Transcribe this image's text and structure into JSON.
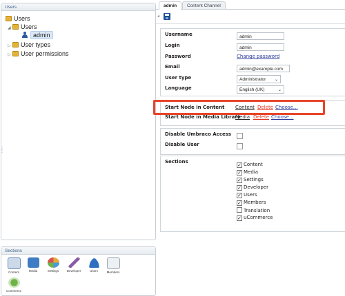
{
  "tree": {
    "header": "Users",
    "root_label": "Users",
    "child_label": "Users",
    "selected_label": "admin",
    "user_types_label": "User types",
    "user_permissions_label": "User permissions"
  },
  "sections": {
    "header": "Sections",
    "items": [
      {
        "label": "Content",
        "icon": "content-icon",
        "color": "#6a8fbf"
      },
      {
        "label": "Media",
        "icon": "media-icon",
        "color": "#3e7cc4"
      },
      {
        "label": "Settings",
        "icon": "settings-icon",
        "color": "#e6a83a"
      },
      {
        "label": "Developer",
        "icon": "developer-icon",
        "color": "#8a5aa8"
      },
      {
        "label": "Users",
        "icon": "users-icon",
        "color": "#2f6fc0"
      },
      {
        "label": "Members",
        "icon": "members-icon",
        "color": "#9aa6b2"
      },
      {
        "label": "Commerce",
        "icon": "commerce-icon",
        "color": "#6fb24a"
      }
    ]
  },
  "tabs": [
    {
      "label": "admin",
      "active": true
    },
    {
      "label": "Content Channel",
      "active": false
    }
  ],
  "form": {
    "username_label": "Username",
    "username_value": "admin",
    "login_label": "Login",
    "login_value": "admin",
    "password_label": "Password",
    "password_link": "Change password",
    "email_label": "Email",
    "email_value": "admin@example.com",
    "user_type_label": "User type",
    "user_type_value": "Administrator",
    "language_label": "Language",
    "language_value": "English (UK)"
  },
  "start_nodes": {
    "content_label": "Start Node in Content",
    "content_value": "Content",
    "delete_label": "Delete",
    "choose_label": "Choose...",
    "media_label": "Start Node in Media Library",
    "media_value": "Media",
    "media_delete_label": "Delete",
    "media_choose_label": "Choose..."
  },
  "access": {
    "disable_umbraco_label": "Disable Umbraco Access",
    "disable_user_label": "Disable User"
  },
  "sections_perm": {
    "label": "Sections",
    "items": [
      {
        "label": "Content",
        "checked": true
      },
      {
        "label": "Media",
        "checked": true
      },
      {
        "label": "Settings",
        "checked": true
      },
      {
        "label": "Developer",
        "checked": true
      },
      {
        "label": "Users",
        "checked": true
      },
      {
        "label": "Members",
        "checked": true
      },
      {
        "label": "Translation",
        "checked": false
      },
      {
        "label": "uCommerce",
        "checked": true
      }
    ]
  },
  "colors": {
    "highlight": "#e8452a",
    "link": "#2a3a9a",
    "delete": "#e2301b"
  }
}
